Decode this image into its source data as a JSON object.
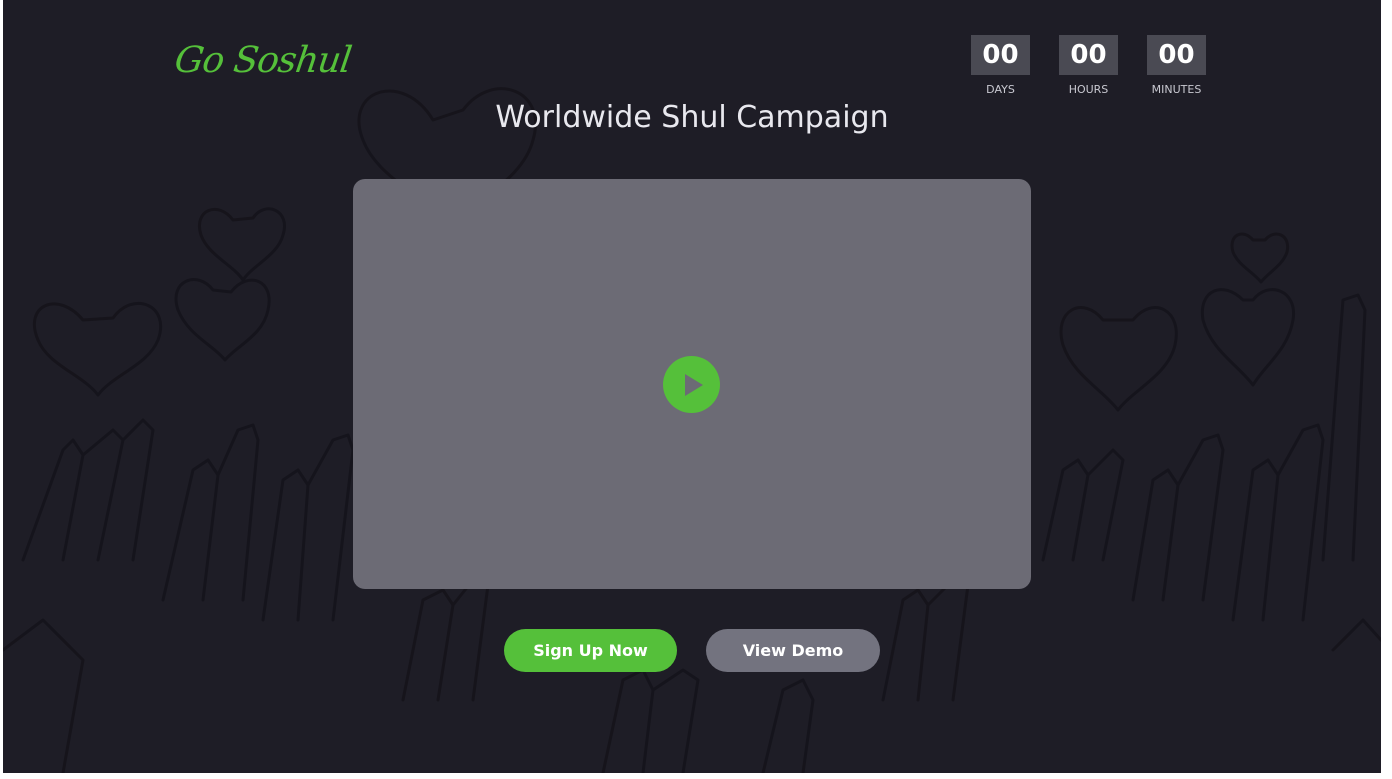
{
  "brand": {
    "logo_text": "Go Soshul",
    "accent_color": "#55c03a"
  },
  "page": {
    "title": "Worldwide Shul Campaign",
    "background_color": "#1e1d26"
  },
  "countdown": [
    {
      "value": "00",
      "label": "DAYS"
    },
    {
      "value": "00",
      "label": "HOURS"
    },
    {
      "value": "00",
      "label": "MINUTES"
    }
  ],
  "video": {
    "play_icon": "play-icon",
    "panel_color": "#6c6b75"
  },
  "actions": {
    "signup_label": "Sign Up Now",
    "demo_label": "View Demo"
  }
}
